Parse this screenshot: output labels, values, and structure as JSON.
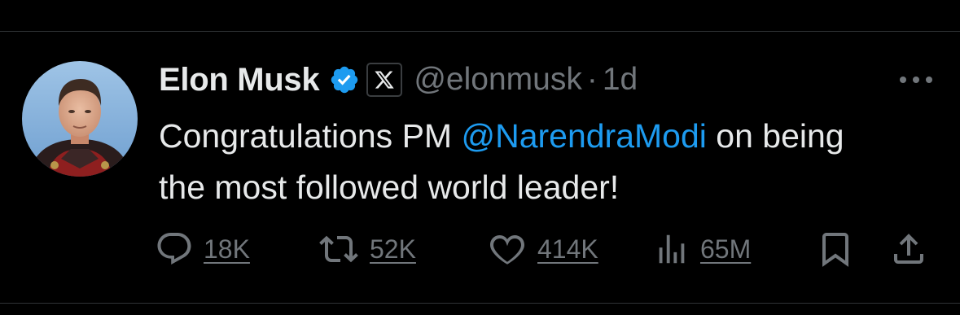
{
  "tweet": {
    "author_name": "Elon Musk",
    "handle": "@elonmusk",
    "separator": "·",
    "time": "1d",
    "text_before": "Congratulations PM ",
    "mention": "@NarendraModi",
    "text_after": " on being the most followed world leader!"
  },
  "stats": {
    "replies": "18K",
    "reposts": "52K",
    "likes": "414K",
    "views": "65M"
  },
  "icons": {
    "verified": "verified-badge-icon",
    "affiliation": "x-logo-icon",
    "more": "more-options-icon",
    "reply": "reply-icon",
    "repost": "repost-icon",
    "like": "heart-icon",
    "views": "views-chart-icon",
    "bookmark": "bookmark-icon",
    "share": "share-icon"
  },
  "colors": {
    "background": "#000000",
    "text_primary": "#e7e9ea",
    "text_secondary": "#71767b",
    "accent": "#1d9bf0",
    "divider": "#2f3336"
  }
}
